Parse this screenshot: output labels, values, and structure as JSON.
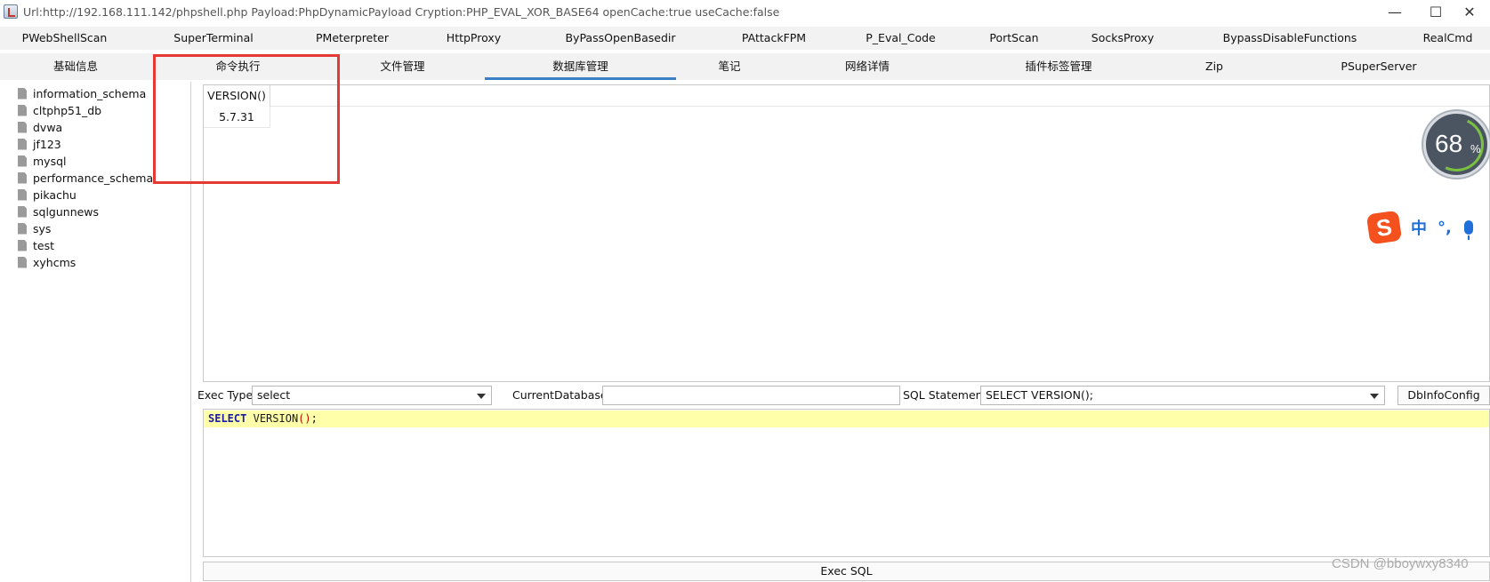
{
  "window": {
    "title": "Url:http://192.168.111.142/phpshell.php Payload:PhpDynamicPayload Cryption:PHP_EVAL_XOR_BASE64 openCache:true useCache:false",
    "minimize": "—",
    "maximize": "☐",
    "close": "✕"
  },
  "plugin_tabs": [
    "PWebShellScan",
    "SuperTerminal",
    "PMeterpreter",
    "HttpProxy",
    "ByPassOpenBasedir",
    "PAttackFPM",
    "P_Eval_Code",
    "PortScan",
    "SocksProxy",
    "BypassDisableFunctions",
    "RealCmd"
  ],
  "main_tabs": [
    "基础信息",
    "命令执行",
    "文件管理",
    "数据库管理",
    "笔记",
    "网络详情",
    "插件标签管理",
    "Zip",
    "PSuperServer"
  ],
  "active_main_tab": "数据库管理",
  "databases": [
    "information_schema",
    "cltphp51_db",
    "dvwa",
    "jf123",
    "mysql",
    "performance_schema",
    "pikachu",
    "sqlgunnews",
    "sys",
    "test",
    "xyhcms"
  ],
  "result": {
    "columns": [
      "VERSION()"
    ],
    "rows": [
      [
        "5.7.31"
      ]
    ]
  },
  "exec_bar": {
    "exec_type_label": "Exec Type",
    "exec_type_value": "select",
    "current_db_label": "CurrentDatabase",
    "current_db_value": "",
    "sql_statement_label": "SQL Statement",
    "sql_statement_value": "SELECT VERSION();",
    "dbinfo_button": "DbInfoConfig"
  },
  "editor": {
    "keyword": "SELECT",
    "function": "VERSION",
    "open_paren": "(",
    "close_paren": ")",
    "terminator": ";"
  },
  "exec_button": "Exec SQL",
  "overlay": {
    "progress_value": "68",
    "progress_unit": "%",
    "ime_chinese": "中",
    "ime_punct": "°,"
  },
  "watermark": "CSDN @bboywxy8340",
  "colors": {
    "active_tab_underline": "#3b7fc4",
    "highlight_box": "#e53935",
    "editor_line_bg": "#ffffaa",
    "ime_brand": "#f4511e"
  }
}
